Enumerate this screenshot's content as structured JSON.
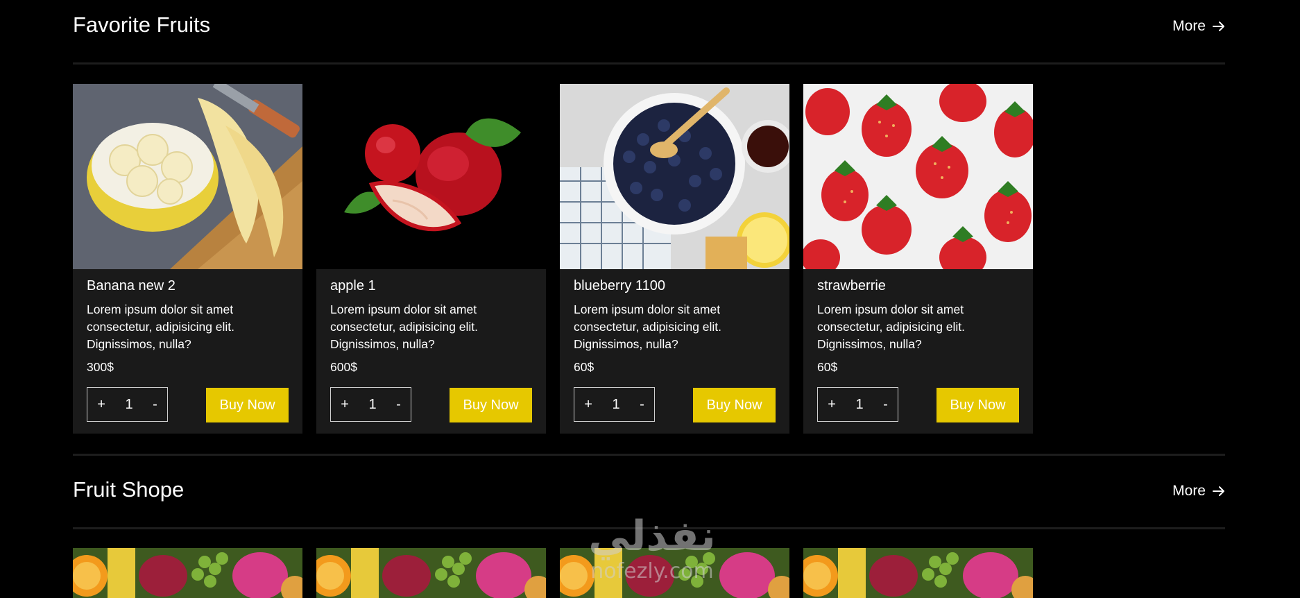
{
  "sections": [
    {
      "title": "Favorite Fruits",
      "more_label": "More",
      "products": [
        {
          "name": "Banana new 2",
          "description": "Lorem ipsum dolor sit amet consectetur, adipisicing elit. Dignissimos, nulla?",
          "price": "300$",
          "quantity": "1",
          "buy_label": "Buy Now"
        },
        {
          "name": "apple 1",
          "description": "Lorem ipsum dolor sit amet consectetur, adipisicing elit. Dignissimos, nulla?",
          "price": "600$",
          "quantity": "1",
          "buy_label": "Buy Now"
        },
        {
          "name": "blueberry 1100",
          "description": "Lorem ipsum dolor sit amet consectetur, adipisicing elit. Dignissimos, nulla?",
          "price": "60$",
          "quantity": "1",
          "buy_label": "Buy Now"
        },
        {
          "name": "strawberrie",
          "description": "Lorem ipsum dolor sit amet consectetur, adipisicing elit. Dignissimos, nulla?",
          "price": "60$",
          "quantity": "1",
          "buy_label": "Buy Now"
        }
      ]
    },
    {
      "title": "Fruit Shope",
      "more_label": "More"
    }
  ],
  "qty_plus": "+",
  "qty_minus": "-",
  "watermark": {
    "arabic": "نفذلي",
    "latin": "nofezly.com"
  },
  "colors": {
    "background": "#000000",
    "card_bg": "#1a1a1a",
    "accent_button": "#e6c800"
  },
  "icons": {
    "more": "arrow-right-icon"
  }
}
